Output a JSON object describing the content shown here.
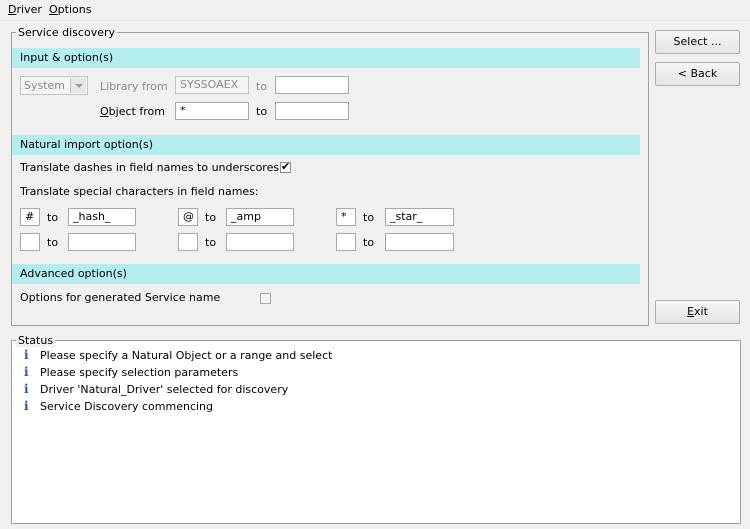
{
  "menu": {
    "driver": {
      "label_first": "D",
      "label_rest": "river"
    },
    "options": {
      "label_first": "O",
      "label_rest": "ptions"
    }
  },
  "service_discovery": {
    "title": "Service discovery",
    "input_section": {
      "header": "Input & option(s)",
      "system_select": "System",
      "library_from_label": "Library from",
      "library_from_value": "SYSSOAEX",
      "library_to_label": "to",
      "library_to_value": "",
      "object_from_label_first": "O",
      "object_from_label_rest": "bject from",
      "object_from_value": "*",
      "object_to_label": "to",
      "object_to_value": ""
    },
    "natural_section": {
      "header": "Natural import option(s)",
      "translate_dashes_label": "Translate dashes in field names to underscores",
      "translate_dashes_checked": true,
      "translate_special_label": "Translate special characters in field names:",
      "to_label": "to",
      "rows": [
        [
          {
            "char": "#",
            "replacement": "_hash_"
          },
          {
            "char": "@",
            "replacement": "_amp"
          },
          {
            "char": "*",
            "replacement": "_star_"
          }
        ],
        [
          {
            "char": "",
            "replacement": ""
          },
          {
            "char": "",
            "replacement": ""
          },
          {
            "char": "",
            "replacement": ""
          }
        ]
      ]
    },
    "advanced_section": {
      "header": "Advanced option(s)",
      "service_name_label": "Options for generated Service name",
      "service_name_checked": false
    }
  },
  "buttons": {
    "select": "Select ...",
    "back": "< Back",
    "exit_first": "E",
    "exit_rest": "xit"
  },
  "status": {
    "title": "Status",
    "icon": "info-icon",
    "messages": [
      "Please specify a Natural Object or a range and select",
      "Please specify selection parameters",
      "Driver 'Natural_Driver' selected for discovery",
      "Service Discovery commencing"
    ]
  }
}
